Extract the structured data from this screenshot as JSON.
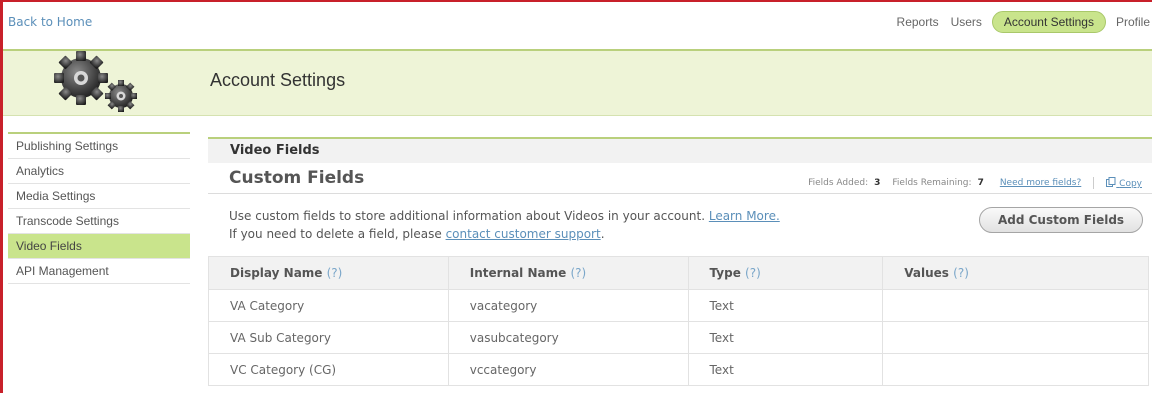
{
  "topbar": {
    "back_link": "Back to Home",
    "nav": [
      {
        "label": "Reports",
        "active": false
      },
      {
        "label": "Users",
        "active": false
      },
      {
        "label": "Account Settings",
        "active": true
      },
      {
        "label": "Profile",
        "active": false
      }
    ]
  },
  "header": {
    "title": "Account Settings",
    "icon": "gears-icon"
  },
  "sidebar": {
    "items": [
      {
        "label": "Publishing Settings",
        "active": false
      },
      {
        "label": "Analytics",
        "active": false
      },
      {
        "label": "Media Settings",
        "active": false
      },
      {
        "label": "Transcode Settings",
        "active": false
      },
      {
        "label": "Video Fields",
        "active": true
      },
      {
        "label": "API Management",
        "active": false
      }
    ]
  },
  "main": {
    "section_title": "Video Fields",
    "custom_fields_title": "Custom Fields",
    "stats": {
      "added_label": "Fields Added:",
      "added_value": "3",
      "remaining_label": "Fields Remaining:",
      "remaining_value": "7",
      "need_more": "Need more fields?",
      "copy": "Copy"
    },
    "description": {
      "line1": "Use custom fields to store additional information about Videos in your account.",
      "learn_more": "Learn More.",
      "line2": "If you need to delete a field, please",
      "support_link": "contact customer support",
      "line2_end": "."
    },
    "add_button": "Add Custom Fields",
    "table": {
      "help": "(?)",
      "columns": [
        "Display Name",
        "Internal Name",
        "Type",
        "Values"
      ],
      "rows": [
        [
          "VA Category",
          "vacategory",
          "Text",
          ""
        ],
        [
          "VA Sub Category",
          "vasubcategory",
          "Text",
          ""
        ],
        [
          "VC Category (CG)",
          "vccategory",
          "Text",
          ""
        ]
      ]
    }
  },
  "colors": {
    "accent_green": "#c9e48c",
    "link_blue": "#5b8fb9",
    "frame_red": "#c8202a"
  }
}
